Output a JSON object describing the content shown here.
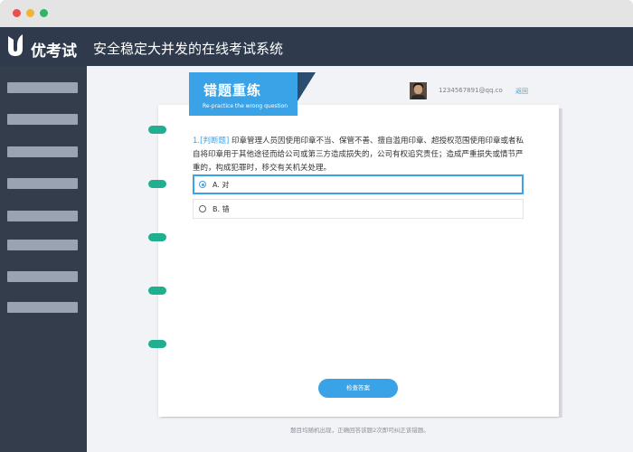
{
  "window": {
    "controls": [
      "close",
      "minimize",
      "maximize"
    ],
    "colors": {
      "close": "#e94f4f",
      "minimize": "#f2b233",
      "maximize": "#30b46a"
    }
  },
  "header": {
    "brand": "优考试",
    "title": "安全稳定大并发的在线考试系统",
    "logo_icon": "u-leaf-logo-icon",
    "bg_color": "#2f3b4c"
  },
  "sidebar": {
    "item_count": 8,
    "bg_color": "#333d4b"
  },
  "ribbon": {
    "title": "错题重练",
    "subtitle": "Re-practice the wrong question",
    "color": "#3aa3e8"
  },
  "user": {
    "avatar_icon": "user-avatar-icon",
    "email": "1234567891@qq.co",
    "back_label": "返回"
  },
  "question": {
    "number": "1.",
    "type_tag": "[判断题]",
    "text": "印章管理人员因使用印章不当、保管不善、擅自滥用印章、超授权范围使用印章或者私自将印章用于其他途径而给公司或第三方造成损失的，公司有权追究责任；造成严重损失或情节严重的，构成犯罪时，移交有关机关处理。",
    "options": [
      {
        "label": "A. 对",
        "selected": true
      },
      {
        "label": "B. 错",
        "selected": false
      }
    ]
  },
  "actions": {
    "check_answer": "检查答案"
  },
  "footer": {
    "note": "题目均随机出现，正确回答该题2次即可纠正该错题。"
  },
  "accent_color": "#3aa3e8",
  "binder_color": "#20b090"
}
